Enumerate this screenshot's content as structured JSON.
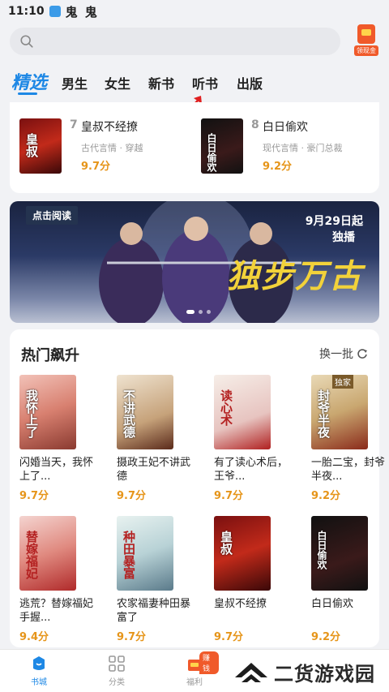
{
  "status_bar": {
    "time": "11:10",
    "extra": "鬼 鬼"
  },
  "search": {
    "placeholder": ""
  },
  "welfare_button": {
    "label": "领现金"
  },
  "tabs": [
    {
      "label": "精选",
      "active": true
    },
    {
      "label": "男生"
    },
    {
      "label": "女生"
    },
    {
      "label": "新书"
    },
    {
      "label": "听书"
    },
    {
      "label": "出版"
    }
  ],
  "ranking": [
    {
      "rank": "7",
      "title": "皇叔不经撩",
      "tags": "古代言情 · 穿越",
      "score": "9.7分",
      "cover_text": "皇叔"
    },
    {
      "rank": "8",
      "title": "白日偷欢",
      "tags": "现代言情 · 豪门总裁",
      "score": "9.2分",
      "cover_text": "白日偷欢"
    }
  ],
  "banner": {
    "tag": "点击阅读",
    "date": "9月29日起",
    "sub": "独播",
    "big_text": "独步万古"
  },
  "hot": {
    "title": "热门飙升",
    "refresh_label": "换一批",
    "books": [
      {
        "title": "闪婚当天，我怀上了...",
        "score": "9.7分",
        "cover_text": "我怀上了"
      },
      {
        "title": "摄政王妃不讲武德",
        "score": "9.7分",
        "cover_text": "不讲武德"
      },
      {
        "title": "有了读心术后，王爷...",
        "score": "9.7分",
        "cover_text": "读心术"
      },
      {
        "title": "一胎二宝，封爷半夜...",
        "score": "9.2分",
        "cover_text": "封爷半夜",
        "badge": "独家"
      },
      {
        "title": "逃荒？替嫁福妃手握...",
        "score": "9.4分",
        "cover_text": "替嫁福妃"
      },
      {
        "title": "农家福妻种田暴富了",
        "score": "9.7分",
        "cover_text": "种田暴富"
      },
      {
        "title": "皇叔不经撩",
        "score": "9.7分",
        "cover_text": "皇叔"
      },
      {
        "title": "白日偷欢",
        "score": "9.2分",
        "cover_text": "白日偷欢"
      }
    ]
  },
  "navbar": [
    {
      "label": "书城",
      "active": true
    },
    {
      "label": "分类"
    },
    {
      "label": "福利",
      "badge": "赚钱"
    }
  ],
  "watermark": {
    "text": "二货游戏园"
  },
  "colors": {
    "accent": "#1e88e5",
    "score": "#e6951a",
    "badge": "#f05a2a"
  }
}
